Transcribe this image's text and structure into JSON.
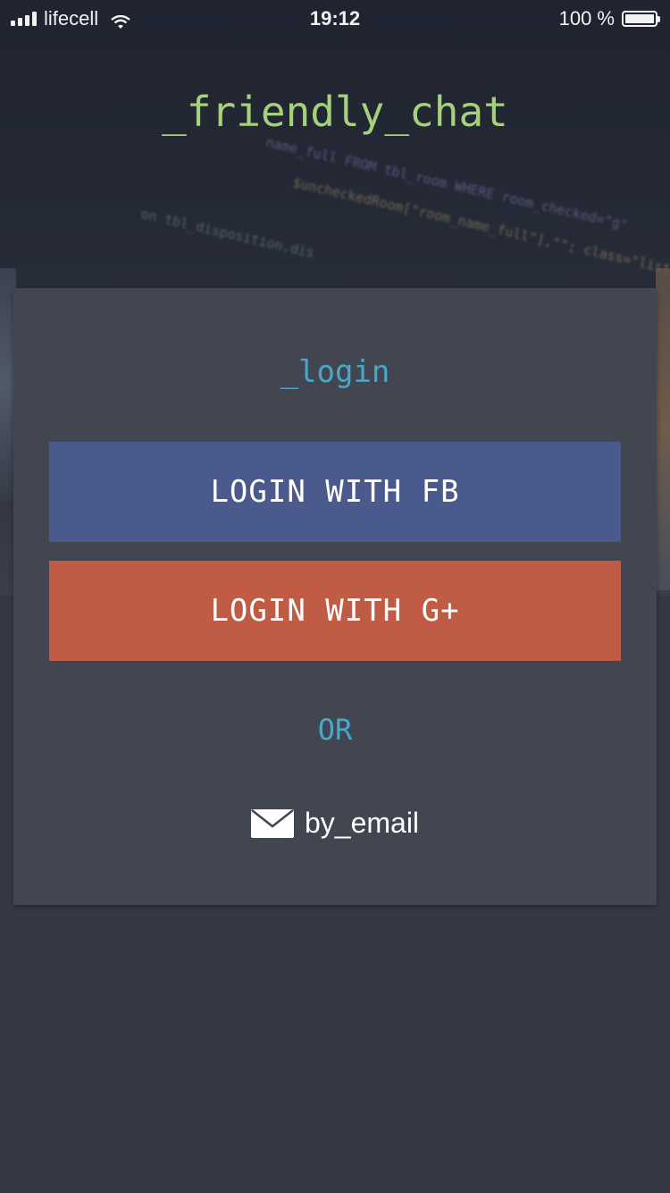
{
  "status_bar": {
    "carrier": "lifecell",
    "time": "19:12",
    "battery": "100 %",
    "battery_level": 1.0
  },
  "app": {
    "title": "_friendly_chat"
  },
  "background_code": [
    "name_full FROM tbl_room WHERE room_checked=\"g\"",
    "$uncheckedRoom[\"room_name_full\"],\"\"; class=\"list-",
    "on tbl_disposition.dis"
  ],
  "login_card": {
    "heading": "_login",
    "fb_button": "LOGIN WITH FB",
    "gplus_button": "LOGIN WITH G+",
    "or_label": "OR",
    "email_label": "by_email"
  },
  "colors": {
    "title_green": "#a6d17c",
    "accent_blue": "#4aa7c9",
    "facebook_blue": "#4a5a8c",
    "google_red": "#c05c45",
    "card_bg": "#424651",
    "page_bg": "#363943"
  },
  "icons": {
    "signal": "signal-bars-icon",
    "wifi": "wifi-icon",
    "battery": "battery-icon",
    "email": "envelope-icon"
  }
}
